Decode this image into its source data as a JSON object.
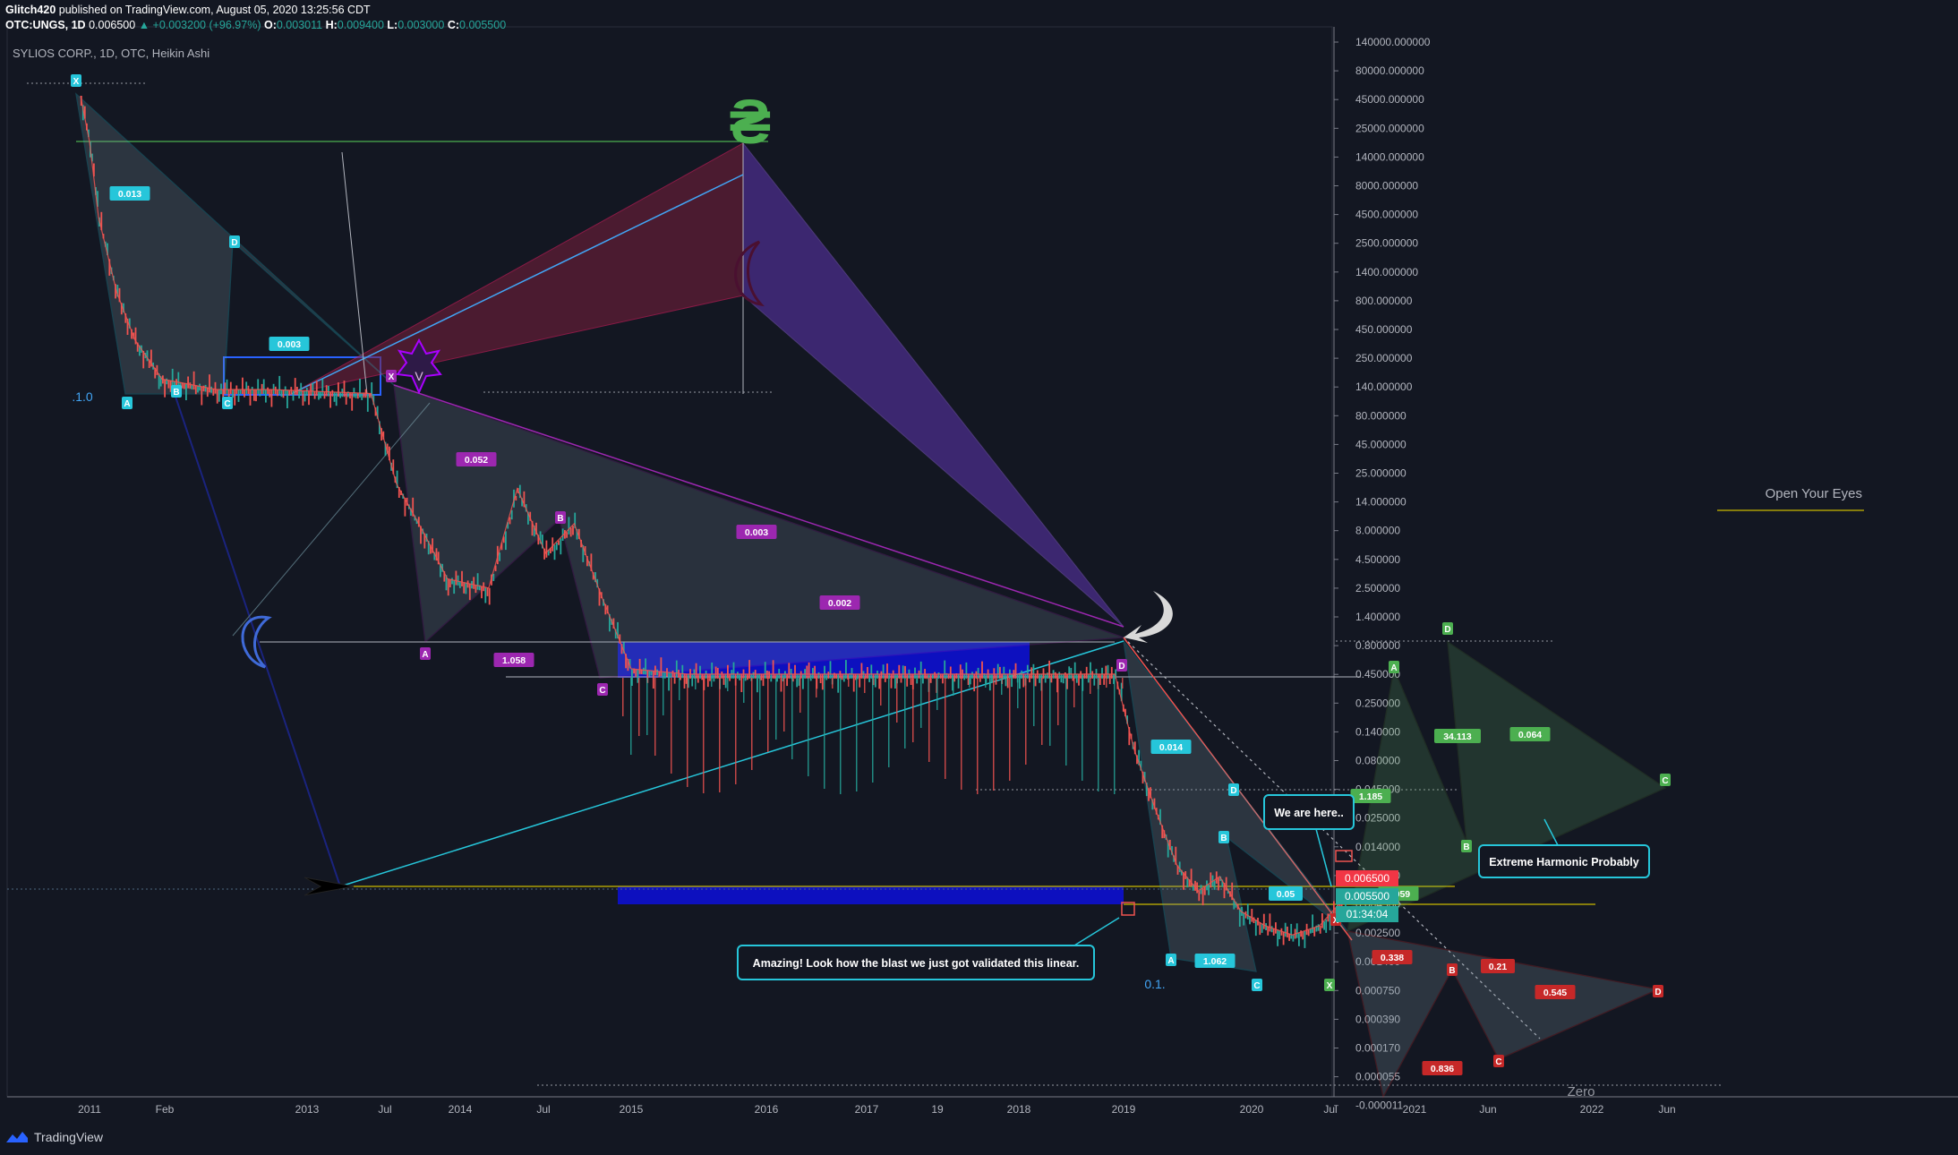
{
  "header": {
    "author": "Glitch420",
    "published_text": "published on TradingView.com, August 05, 2020 13:25:56 CDT",
    "symbol": "OTC:UNGS, 1D",
    "last": "0.006500",
    "change": "▲ +0.003200 (+96.97%)",
    "o_label": "O:",
    "o": "0.003011",
    "h_label": "H:",
    "h": "0.009400",
    "l_label": "L:",
    "l": "0.003000",
    "c_label": "C:",
    "c": "0.005500"
  },
  "chart_title": "SYLIOS CORP., 1D, OTC, Heikin Ashi",
  "footer": {
    "brand": "TradingView"
  },
  "colors": {
    "background": "#131722",
    "up": "#26a69a",
    "down": "#ef5350",
    "cyan": "#00bcd4",
    "purple": "#9c27b0",
    "green": "#4caf50",
    "red": "#b71c1c",
    "blue_zone": "#0d10c8"
  },
  "chart_data": {
    "type": "line",
    "title": "SYLIOS CORP., 1D, OTC, Heikin Ashi",
    "y_scale": "log",
    "ylim": [
      1.1e-05,
      140000
    ],
    "y_ticks": [
      "140000.000000",
      "80000.000000",
      "45000.000000",
      "25000.000000",
      "14000.000000",
      "8000.000000",
      "4500.000000",
      "2500.000000",
      "1400.000000",
      "800.000000",
      "450.000000",
      "250.000000",
      "140.000000",
      "80.000000",
      "45.000000",
      "25.000000",
      "14.000000",
      "8.000000",
      "4.500000",
      "2.500000",
      "1.400000",
      "0.800000",
      "0.450000",
      "0.250000",
      "0.140000",
      "0.080000",
      "0.045000",
      "0.025000",
      "0.014000",
      "0.008000",
      "0.004500",
      "0.002500",
      "0.001400",
      "0.000750",
      "0.000390",
      "0.000170",
      "0.000055",
      "-0.000011"
    ],
    "x_ticks": [
      "2011",
      "Feb",
      "2013",
      "Jul",
      "2014",
      "Jul",
      "2015",
      "2016",
      "2017",
      "19",
      "2018",
      "2019",
      "2020",
      "Jul",
      "2021",
      "Jun",
      "2022",
      "Jun"
    ],
    "price_labels": [
      {
        "value": "0.006500",
        "color": "#f23645"
      },
      {
        "value": "0.005500",
        "color": "#26a69a"
      },
      {
        "value": "01:34:04",
        "color": "#26a69a"
      }
    ],
    "series": [
      {
        "name": "Heikin Ashi close",
        "points": [
          [
            "2010-12",
            45000
          ],
          [
            "2011-01",
            18000
          ],
          [
            "2011-02",
            4000
          ],
          [
            "2011-04",
            900
          ],
          [
            "2011-06",
            350
          ],
          [
            "2011-09",
            160
          ],
          [
            "2012-03",
            130
          ],
          [
            "2012-09",
            130
          ],
          [
            "2013-02",
            125
          ],
          [
            "2013-06",
            120
          ],
          [
            "2013-08",
            20
          ],
          [
            "2013-10",
            8
          ],
          [
            "2013-12",
            3
          ],
          [
            "2014-03",
            2.5
          ],
          [
            "2014-05",
            18
          ],
          [
            "2014-07",
            5
          ],
          [
            "2014-09",
            9
          ],
          [
            "2014-11",
            2
          ],
          [
            "2015-01",
            0.5
          ],
          [
            "2015-06",
            0.45
          ],
          [
            "2016-01",
            0.45
          ],
          [
            "2016-06",
            0.45
          ],
          [
            "2017-01",
            0.45
          ],
          [
            "2017-06",
            0.45
          ],
          [
            "2018-01",
            0.45
          ],
          [
            "2018-06",
            0.45
          ],
          [
            "2018-12",
            0.45
          ],
          [
            "2019-02",
            0.1
          ],
          [
            "2019-04",
            0.03
          ],
          [
            "2019-06",
            0.01
          ],
          [
            "2019-08",
            0.006
          ],
          [
            "2019-10",
            0.008
          ],
          [
            "2019-12",
            0.004
          ],
          [
            "2020-02",
            0.003
          ],
          [
            "2020-04",
            0.0025
          ],
          [
            "2020-06",
            0.003
          ],
          [
            "2020-08",
            0.0055
          ]
        ]
      }
    ],
    "annotations": [
      {
        "text": "We are here..",
        "type": "callout"
      },
      {
        "text": "Amazing! Look how the blast we just got validated this linear.",
        "type": "callout"
      },
      {
        "text": "Extreme Harmonic Probably",
        "type": "callout"
      },
      {
        "text": "Open Your Eyes",
        "type": "text"
      },
      {
        "text": "Zero",
        "type": "text"
      },
      {
        "text": ".1.0",
        "type": "text"
      },
      {
        "text": "0.1.",
        "type": "text"
      }
    ],
    "harmonic_patterns": [
      {
        "color": "cyan",
        "points": [
          "X",
          "A",
          "B",
          "C",
          "D"
        ],
        "ratios": [
          "0.013",
          "0.003"
        ]
      },
      {
        "color": "purple",
        "points": [
          "X",
          "A",
          "B",
          "C",
          "D"
        ],
        "ratios": [
          "0.052",
          "1.058",
          "0.003",
          "0.002"
        ]
      },
      {
        "color": "cyan",
        "points": [
          "X",
          "A",
          "B",
          "C",
          "D"
        ],
        "ratios": [
          "0.014",
          "1.062",
          "0.05"
        ]
      },
      {
        "color": "green",
        "points": [
          "X",
          "A",
          "B",
          "C",
          "D"
        ],
        "ratios": [
          "1.185",
          "34.113",
          "0.064",
          "0.959"
        ]
      },
      {
        "color": "red",
        "points": [
          "X",
          "B",
          "C",
          "D"
        ],
        "ratios": [
          "0.338",
          "0.21",
          "0.545",
          "0.836"
        ]
      }
    ]
  }
}
